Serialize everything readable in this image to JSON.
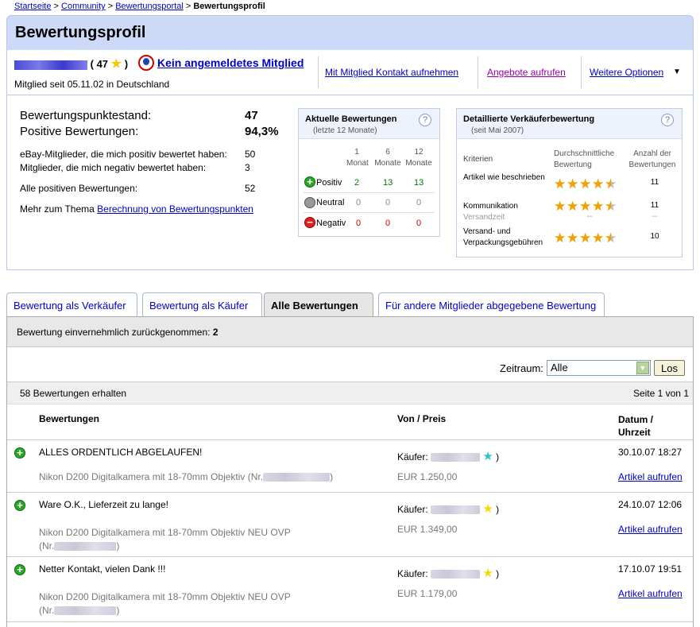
{
  "breadcrumb": [
    "Startseite",
    "Community",
    "Bewertungsportal",
    "Bewertungsprofil"
  ],
  "page": {
    "title": "Bewertungsprofil"
  },
  "user": {
    "score": "( 47",
    "score_close": ")",
    "not_logged": "Kein angemeldetes Mitglied",
    "member_since": "Mitglied seit 05.11.02 in Deutschland"
  },
  "actions": {
    "contact": "Mit Mitglied Kontakt aufnehmen",
    "offers": "Angebote aufrufen",
    "more": "Weitere Optionen"
  },
  "stats": {
    "points_label": "Bewertungspunktestand:",
    "points": "47",
    "positive_label": "Positive Bewertungen:",
    "positive": "94,3%",
    "pos_members_label": "eBay-Mitglieder, die mich positiv bewertet haben:",
    "pos_members": "50",
    "neg_members_label": "Mitglieder, die mich negativ bewertet haben:",
    "neg_members": "3",
    "all_pos_label": "Alle positiven Bewertungen:",
    "all_pos": "52",
    "more_label": "Mehr zum Thema",
    "more_link": "Berechnung von Bewertungspunkten"
  },
  "recent": {
    "title": "Aktuelle Bewertungen",
    "subtitle": "(letzte 12 Monate)",
    "help": "?",
    "cols": [
      [
        "1",
        "Monat"
      ],
      [
        "6",
        "Monate"
      ],
      [
        "12",
        "Monate"
      ]
    ],
    "rows": [
      {
        "label": "Positiv",
        "v": [
          "2",
          "13",
          "13"
        ]
      },
      {
        "label": "Neutral",
        "v": [
          "0",
          "0",
          "0"
        ]
      },
      {
        "label": "Negativ",
        "v": [
          "0",
          "0",
          "0"
        ]
      }
    ]
  },
  "seller": {
    "title": "Detaillierte Verkäuferbewertung",
    "subtitle": "(seit Mai 2007)",
    "help": "?",
    "h_crit": "Kriterien",
    "h_avg": "Durchschnittliche Bewertung",
    "h_count": "Anzahl der Bewertungen",
    "rows": [
      {
        "crit": "Artikel wie beschrieben",
        "rating": 4.5,
        "count": "11"
      },
      {
        "crit": "Kommunikation",
        "rating": 4.5,
        "count": "11"
      },
      {
        "crit": "Versandzeit",
        "rating": null,
        "avg_text": "--",
        "count": "--"
      },
      {
        "crit": "Versand- und Verpackungsgebühren",
        "rating": 4.5,
        "count": "10"
      }
    ]
  },
  "tabs": [
    "Bewertung als Verkäufer",
    "Bewertung als Käufer",
    "Alle Bewertungen",
    "Für andere Mitglieder abgegebene Bewertung"
  ],
  "withdrawn": {
    "label": "Bewertung einvernehmlich zurückgenommen:",
    "count": "2"
  },
  "filter": {
    "label": "Zeitraum:",
    "value": "Alle",
    "button": "Los"
  },
  "list": {
    "received": "58 Bewertungen erhalten",
    "page": "Seite 1 von 1",
    "h_feedback": "Bewertungen",
    "h_from": "Von / Preis",
    "h_date": "Datum /",
    "h_date2": "Uhrzeit"
  },
  "entries": [
    {
      "text": "ALLES ORDENTLICH ABGELAUFEN!",
      "item": "Nikon D200 Digitalkamera mit 18-70mm Objektiv (Nr.",
      "item_end": ")",
      "buyer": "Käufer:",
      "price": "EUR 1.250,00",
      "date": "30.10.07 18:27",
      "link": "Artikel aufrufen",
      "star": "#2ec4c4"
    },
    {
      "text": "Ware O.K., Lieferzeit zu lange!",
      "item": "Nikon D200 Digitalkamera mit 18-70mm Objektiv NEU OVP",
      "item2": "(Nr.",
      "item_end": ")",
      "buyer": "Käufer:",
      "price": "EUR 1.349,00",
      "date": "24.10.07 12:06",
      "link": "Artikel aufrufen",
      "star": "#f5d800"
    },
    {
      "text": "Netter Kontakt, vielen Dank !!!",
      "item": "Nikon D200 Digitalkamera mit 18-70mm Objektiv NEU OVP",
      "item2": "(Nr.",
      "item_end": ")",
      "buyer": "Käufer:",
      "price": "EUR 1.179,00",
      "date": "17.10.07 19:51",
      "link": "Artikel aufrufen",
      "star": "#f5d800"
    }
  ]
}
